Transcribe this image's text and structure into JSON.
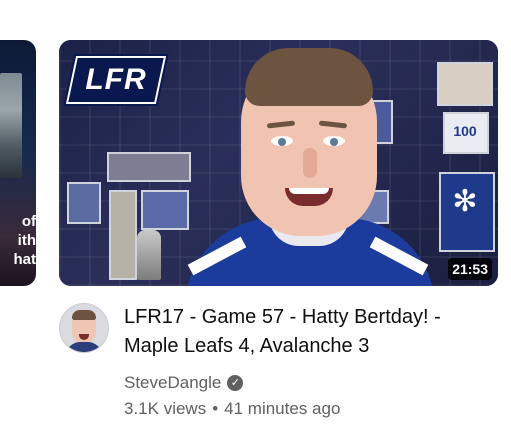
{
  "previous_card": {
    "thumbnail_text": " of\nith\nhat"
  },
  "video": {
    "logo_text": "LFR",
    "duration": "21:53",
    "title": "LFR17 - Game 57 - Hatty Bertday! - Maple Leafs 4, Avalanche 3",
    "channel": "SteveDangle",
    "verified_icon": "check-icon",
    "views": "3.1K views",
    "separator": "•",
    "age": "41 minutes ago",
    "wall_badge": "100",
    "wall_leaf_icon": "maple-leaf-icon"
  },
  "colors": {
    "title": "#0f0f0f",
    "secondary_text": "#606060",
    "duration_bg": "#000000"
  }
}
